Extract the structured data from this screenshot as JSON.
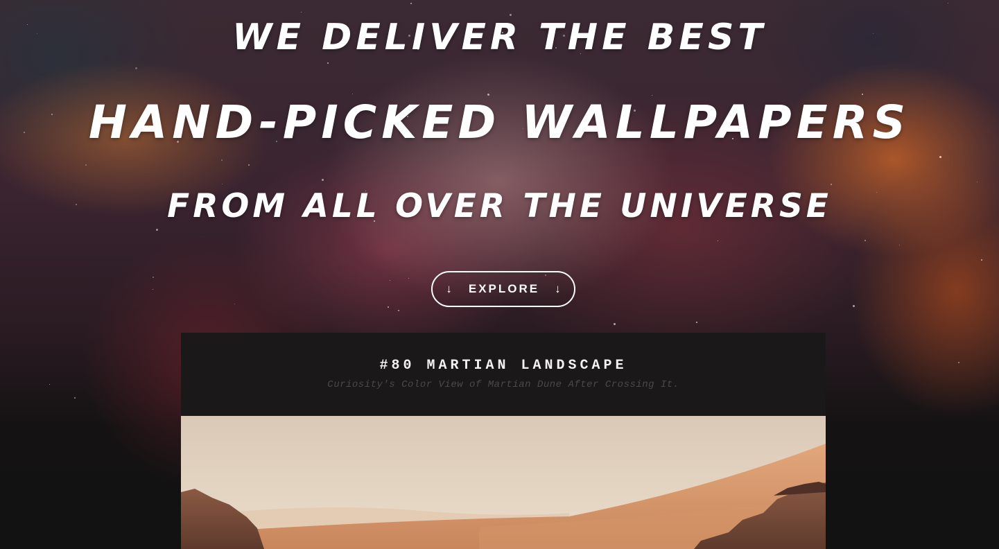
{
  "hero": {
    "line1": "WE DELIVER THE BEST",
    "line2": "HAND-PICKED WALLPAPERS",
    "line3": "FROM ALL OVER THE UNIVERSE",
    "explore_label": "EXPLORE",
    "explore_icon_left": "arrow-down-icon",
    "explore_icon_right": "arrow-down-icon"
  },
  "wallpaper": {
    "title": "#80 MARTIAN LANDSCAPE",
    "subtitle": "Curiosity's Color View of Martian Dune After Crossing It."
  },
  "colors": {
    "card_background": "#1a1818",
    "text": "#ffffff",
    "subtitle_text": "#4a4a4a"
  }
}
